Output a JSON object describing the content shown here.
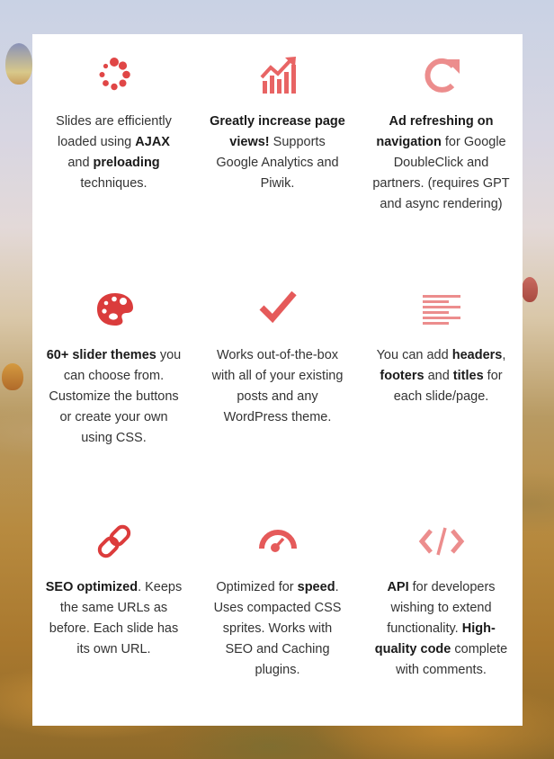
{
  "colors": {
    "accent_red": "#e04646",
    "accent_soft": "#e86464",
    "accent_pale": "#ec8d8d",
    "text": "#333333",
    "text_bold": "#1a1a1a",
    "panel": "#ffffff"
  },
  "features": [
    {
      "icon": "spinner-icon",
      "parts": [
        {
          "t": "Slides are efficiently loaded using ",
          "b": false
        },
        {
          "t": "AJAX",
          "b": true
        },
        {
          "t": " and ",
          "b": false
        },
        {
          "t": "preloading",
          "b": true
        },
        {
          "t": " techniques.",
          "b": false
        }
      ]
    },
    {
      "icon": "growth-chart-icon",
      "parts": [
        {
          "t": "Greatly increase page views!",
          "b": true
        },
        {
          "t": " Supports Google Analytics and Piwik.",
          "b": false
        }
      ]
    },
    {
      "icon": "refresh-icon",
      "parts": [
        {
          "t": "Ad refreshing on navigation",
          "b": true
        },
        {
          "t": " for Google DoubleClick and partners. (requires GPT and async rendering)",
          "b": false
        }
      ]
    },
    {
      "icon": "palette-icon",
      "parts": [
        {
          "t": "60+ slider themes",
          "b": true
        },
        {
          "t": " you can choose from. Customize the buttons or create your own using CSS.",
          "b": false
        }
      ]
    },
    {
      "icon": "checkmark-icon",
      "parts": [
        {
          "t": "Works out-of-the-box with all of your existing posts and any WordPress theme.",
          "b": false
        }
      ]
    },
    {
      "icon": "text-align-icon",
      "parts": [
        {
          "t": "You can add ",
          "b": false
        },
        {
          "t": "headers",
          "b": true
        },
        {
          "t": ", ",
          "b": false
        },
        {
          "t": "footers",
          "b": true
        },
        {
          "t": " and ",
          "b": false
        },
        {
          "t": "titles",
          "b": true
        },
        {
          "t": " for each slide/page.",
          "b": false
        }
      ]
    },
    {
      "icon": "link-icon",
      "parts": [
        {
          "t": "SEO optimized",
          "b": true
        },
        {
          "t": ". Keeps the same URLs as before. Each slide has its own URL.",
          "b": false
        }
      ]
    },
    {
      "icon": "speedometer-icon",
      "parts": [
        {
          "t": "Optimized for ",
          "b": false
        },
        {
          "t": "speed",
          "b": true
        },
        {
          "t": ". Uses compacted CSS sprites. Works with SEO and Caching plugins.",
          "b": false
        }
      ]
    },
    {
      "icon": "code-icon",
      "parts": [
        {
          "t": "API",
          "b": true
        },
        {
          "t": " for developers wishing to extend functionality. ",
          "b": false
        },
        {
          "t": "High-quality code",
          "b": true
        },
        {
          "t": " complete with comments.",
          "b": false
        }
      ]
    }
  ]
}
